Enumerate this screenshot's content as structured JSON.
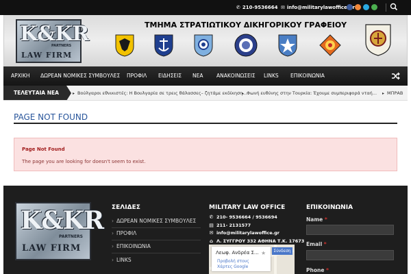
{
  "topbar": {
    "phone": "210-9536664",
    "email": "info@militarylawoffice.gr",
    "social": [
      {
        "icon": "facebook-icon",
        "color": "#3b5998"
      },
      {
        "icon": "rss-icon",
        "color": "#f0873a"
      },
      {
        "icon": "twitter-icon",
        "color": "#2aa9e0"
      },
      {
        "icon": "email-icon",
        "color": "#4caf50"
      }
    ]
  },
  "header": {
    "title": "ΤΜΗΜΑ ΣΤΡΑΤΙΩΤΙΚΟΥ ΔΙΚΗΓΟΡΙΚΟΥ ΓΡΑΦΕΙΟΥ",
    "logo": {
      "letters": "K&KR",
      "partners": "PARTNERS",
      "firm": "LAW FIRM"
    }
  },
  "nav": {
    "items": [
      "ΑΡΧΙΚΗ",
      "ΔΩΡΕΑΝ ΝΟΜΙΚΕΣ ΣΥΜΒΟΥΛΕΣ",
      "ΠΡΟΦΙΛ",
      "ΕΙΔΗΣΕΙΣ",
      "ΝΕΑ",
      "ΑΝΑΚΟΙΝΩΣΕΙΣ",
      "LINKS",
      "ΕΠΙΚΟΙΝΩΝΙΑ"
    ]
  },
  "ticker": {
    "label": "ΤΕΛΕΥΤΑΙΑ ΝΕΑ",
    "items": [
      "Βούλγαροι εθνικιστές: Η Βουλγαρία σε τρεις θάλασσες– ζητάμε εκδίκηση...",
      "Φωνή ευθύνης στην Τουρκία: Έχουμε συμπεριφορά νταή...",
      "ΜΠΡΑΒ"
    ]
  },
  "main": {
    "title": "PAGE NOT FOUND",
    "alert_title": "Page Not Found",
    "alert_text": "The page you are looking for doesn't seem to exist."
  },
  "footer": {
    "pages_title": "ΣΕΛΙΔΕΣ",
    "pages": [
      "ΔΩΡΕΑΝ ΝΟΜΙΚΕΣ ΣΥΜΒΟΥΛΕΣ",
      "ΠΡΟΦΙΛ",
      "ΕΠΙΚΟΙΝΩΝΙΑ",
      "LINKS"
    ],
    "office_title": "MILITARY LAW OFFICE",
    "phone": "210- 9536664 / 9536694",
    "fax": "211- 2131577",
    "email": "info@militarylawoffice.gr",
    "address": "Λ. ΣΥΓΓΡΟΥ 332 ΑΘΗΝΑ Τ.Κ. 17673",
    "map": {
      "place": "Λεωφ. Ανδρέα Σ...",
      "link": "Προβολή στους Χάρτες Google",
      "signin": "Σύνδεση"
    },
    "contact_title": "ΕΠΙΚΟΙΝΩΝΙΑ",
    "name_label": "Name",
    "email_label": "Email",
    "phone_label": "Phone",
    "required_mark": "*"
  }
}
